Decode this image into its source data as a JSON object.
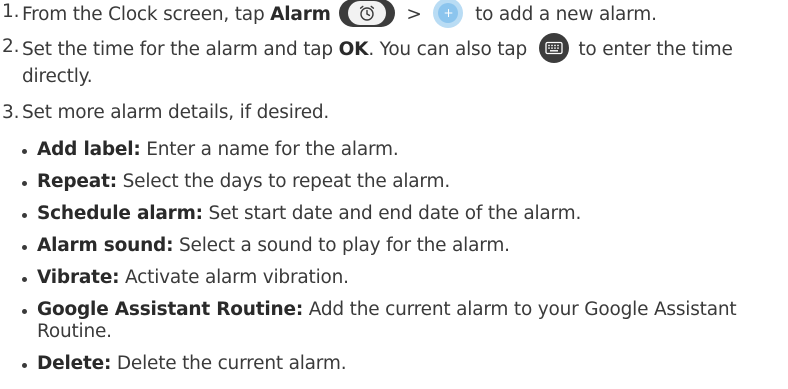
{
  "steps": [
    {
      "num": "1.",
      "before_bold": "From the Clock screen, tap ",
      "bold": "Alarm",
      "between": " > ",
      "after": " to add a new alarm.",
      "alarm_icon": "alarm-clock-icon",
      "add_icon": "add-icon"
    },
    {
      "num": "2.",
      "before_bold": "Set the time for the alarm and tap ",
      "bold": "OK",
      "mid": ". You can also tap ",
      "after": " to enter the time directly.",
      "keyboard_icon": "keyboard-icon"
    },
    {
      "num": "3.",
      "text": "Set more alarm details, if desired."
    }
  ],
  "details": [
    {
      "term": "Add label:",
      "desc": " Enter a name for the alarm."
    },
    {
      "term": "Repeat:",
      "desc": " Select the days to repeat the alarm."
    },
    {
      "term": "Schedule alarm:",
      "desc": " Set start date and end date of the alarm."
    },
    {
      "term": "Alarm sound:",
      "desc": " Select a sound to play for the alarm."
    },
    {
      "term": "Vibrate:",
      "desc": " Activate alarm vibration."
    },
    {
      "term": "Google Assistant Routine:",
      "desc": " Add the current alarm to your Google Assistant Routine."
    },
    {
      "term": "Delete:",
      "desc": " Delete the current alarm."
    }
  ],
  "colors": {
    "text": "#3a3a3a",
    "icon_dark": "#3c3c3c",
    "add_circle": "#8cc5ee"
  }
}
